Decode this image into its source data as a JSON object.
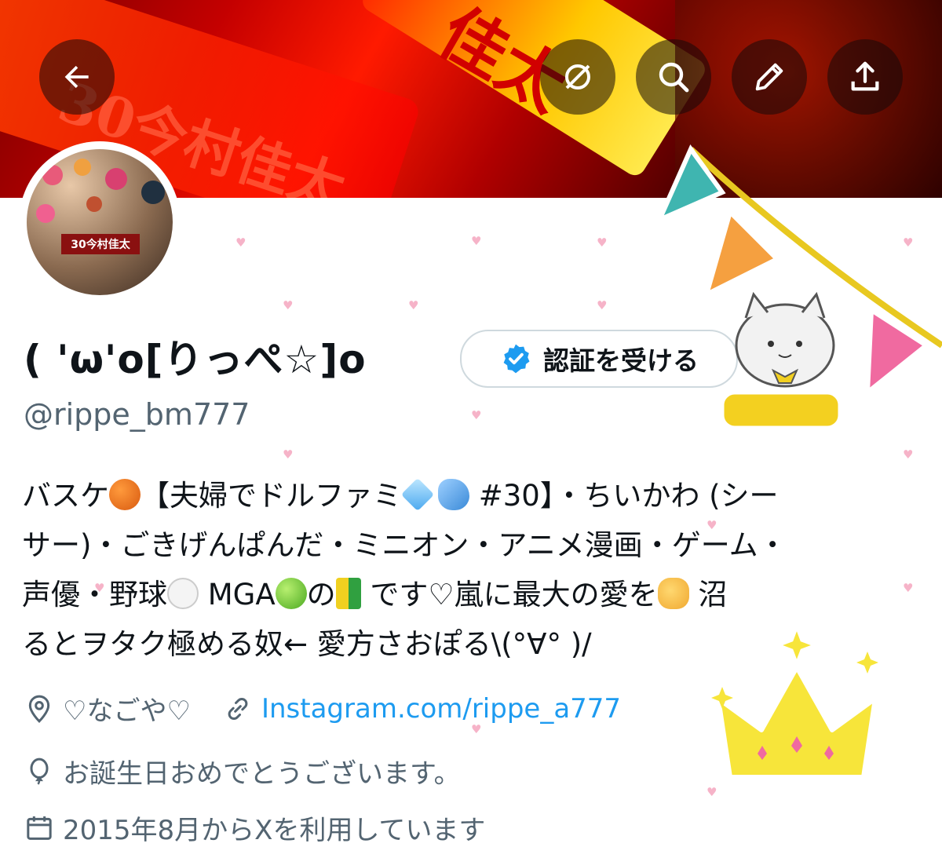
{
  "header": {
    "back_icon": "arrow-left-icon",
    "toolbar_icons": [
      "grok-icon",
      "search-icon",
      "edit-icon",
      "share-icon"
    ],
    "banner_text": [
      "佳太",
      "30今村佳太"
    ]
  },
  "profile": {
    "avatar_text": "30今村佳太",
    "display_name": "( 'ω'o[りっぺ☆]o",
    "verify_button_label": "認証を受ける",
    "handle": "@rippe_bm777",
    "bio": {
      "line1_a": "バスケ",
      "line1_b": "【夫婦でドルファミ",
      "line1_c": " #30】・ちいかわ (シー",
      "line2": "サー)・ごきげんぱんだ・ミニオン・アニメ漫画・ゲーム・",
      "line3_a": "声優・野球",
      "line3_b": " MGA",
      "line3_c": "の",
      "line3_d": " です♡嵐に最大の愛を",
      "line3_e": " 沼",
      "line4": "るとヲタク極める奴← 愛方さおぽる\\(°∀° )/"
    },
    "location": "♡なごや♡",
    "website": "Instagram.com/rippe_a777",
    "birthday": "お誕生日おめでとうございます。",
    "joined_partial": "2015年8月からXを利用しています"
  },
  "colors": {
    "accent": "#1d9bf0",
    "muted": "#536471",
    "heart": "#f6b3c8"
  }
}
